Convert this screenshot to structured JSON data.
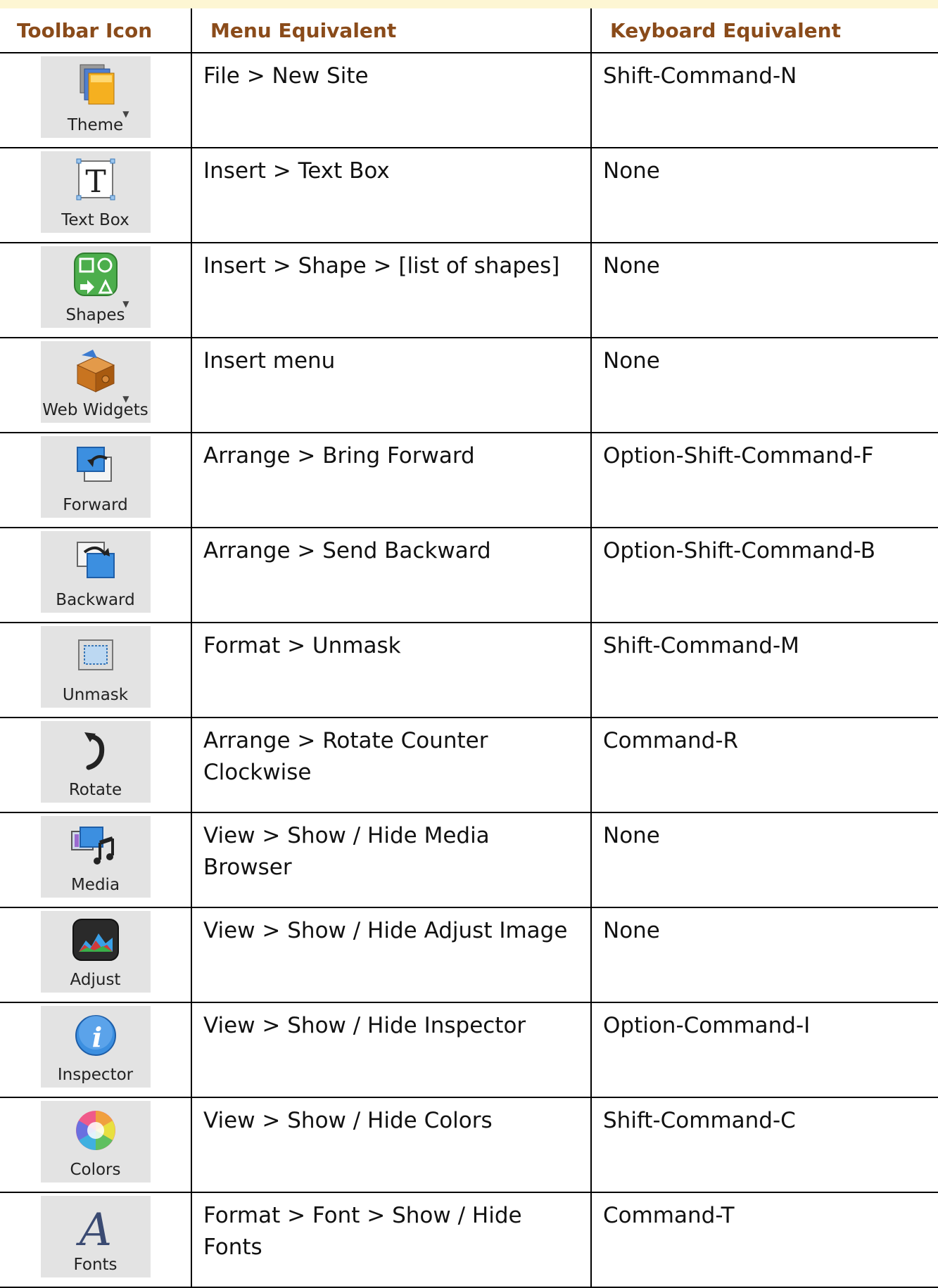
{
  "header": {
    "col1": "Toolbar Icon",
    "col2": "Menu Equivalent",
    "col3": "Keyboard Equivalent"
  },
  "rows": [
    {
      "icon": "theme-icon",
      "label": "Theme",
      "menu": "File > New Site",
      "key": "Shift-Command-N"
    },
    {
      "icon": "text-box-icon",
      "label": "Text Box",
      "menu": "Insert > Text Box",
      "key": "None"
    },
    {
      "icon": "shapes-icon",
      "label": "Shapes",
      "menu": "Insert > Shape > [list of shapes]",
      "key": "None"
    },
    {
      "icon": "web-widgets-icon",
      "label": "Web Widgets",
      "menu": "Insert menu",
      "key": "None"
    },
    {
      "icon": "forward-icon",
      "label": "Forward",
      "menu": "Arrange > Bring Forward",
      "key": "Option-Shift-Command-F"
    },
    {
      "icon": "backward-icon",
      "label": "Backward",
      "menu": "Arrange > Send Backward",
      "key": "Option-Shift-Command-B"
    },
    {
      "icon": "unmask-icon",
      "label": "Unmask",
      "menu": "Format > Unmask",
      "key": "Shift-Command-M"
    },
    {
      "icon": "rotate-icon",
      "label": "Rotate",
      "menu": "Arrange > Rotate Counter Clockwise",
      "key": "Command-R"
    },
    {
      "icon": "media-icon",
      "label": "Media",
      "menu": "View > Show / Hide Media Browser",
      "key": "None"
    },
    {
      "icon": "adjust-icon",
      "label": "Adjust",
      "menu": "View > Show / Hide Adjust Image",
      "key": "None"
    },
    {
      "icon": "inspector-icon",
      "label": "Inspector",
      "menu": "View > Show / Hide Inspector",
      "key": "Option-Command-I"
    },
    {
      "icon": "colors-icon",
      "label": "Colors",
      "menu": "View > Show / Hide Colors",
      "key": "Shift-Command-C"
    },
    {
      "icon": "fonts-icon",
      "label": "Fonts",
      "menu": "Format > Font > Show / Hide Fonts",
      "key": "Command-T"
    }
  ]
}
